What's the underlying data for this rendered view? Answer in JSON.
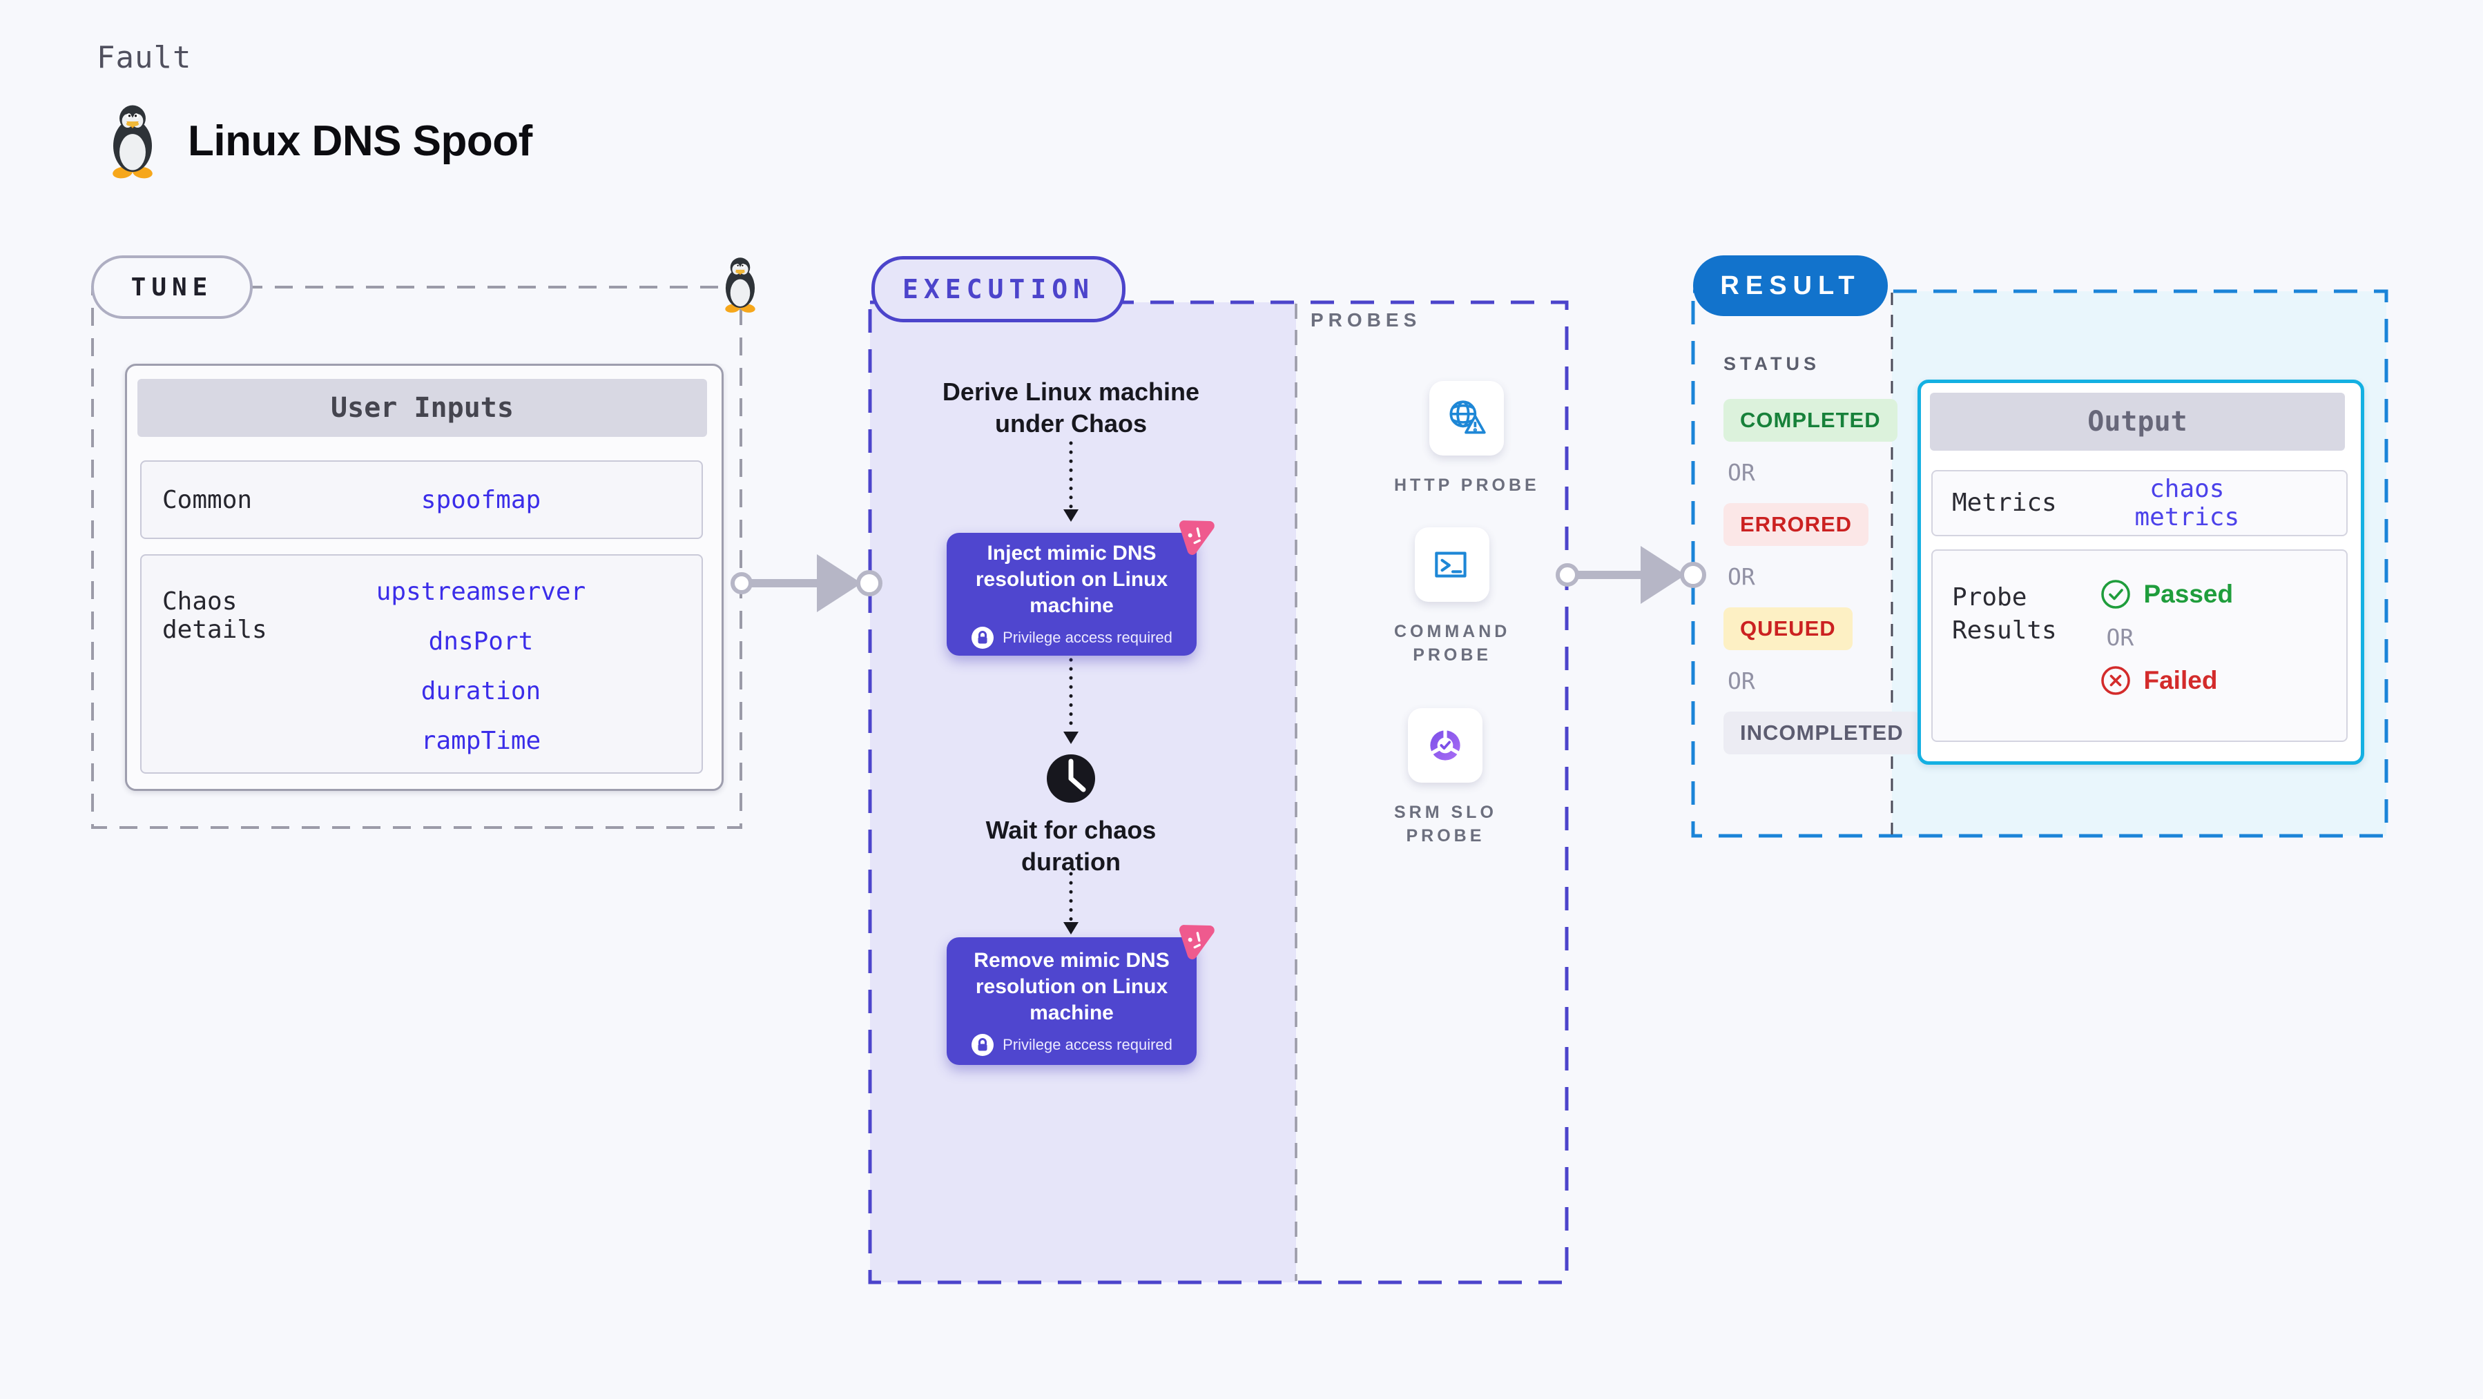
{
  "page": {
    "eyebrow": "Fault",
    "title": "Linux DNS Spoof",
    "background": "#f7f8fc"
  },
  "tune": {
    "label": "TUNE",
    "card_header": "User Inputs",
    "rows": [
      {
        "label": "Common",
        "values": [
          "spoofmap"
        ]
      },
      {
        "label": "Chaos details",
        "values": [
          "upstreamserver",
          "dnsPort",
          "duration",
          "rampTime"
        ]
      }
    ],
    "value_color": "#3b2de9",
    "border_color": "#9b9ba8"
  },
  "execution": {
    "label": "EXECUTION",
    "accent": "#4c44cb",
    "panel_color": "#e6e5f9",
    "steps": {
      "derive": "Derive Linux machine\nunder Chaos",
      "inject": "Inject mimic DNS\nresolution on Linux\nmachine",
      "wait": "Wait for chaos\nduration",
      "remove": "Remove mimic DNS\nresolution on Linux\nmachine",
      "privilege": "Privilege access required"
    },
    "card_color": "#4f46cf",
    "badge_color": "#ef5a8e"
  },
  "probes": {
    "label": "PROBES",
    "items": [
      {
        "label": "HTTP PROBE",
        "icon": "globe-alert-icon"
      },
      {
        "label": "COMMAND\nPROBE",
        "icon": "terminal-icon"
      },
      {
        "label": "SRM SLO\nPROBE",
        "icon": "slo-donut-check-icon"
      }
    ],
    "icon_blue": "#1e87d6",
    "icon_purple": "#8a5cf0"
  },
  "result": {
    "label": "RESULT",
    "accent": "#1b84d8",
    "pill_color": "#1273cc",
    "panel_color": "#e9f6fc",
    "status_heading": "STATUS",
    "or": "OR",
    "statuses": [
      {
        "label": "COMPLETED",
        "fg": "#17813a",
        "bg": "#dcf2dc"
      },
      {
        "label": "ERRORED",
        "fg": "#cb2121",
        "bg": "#fbe7e7"
      },
      {
        "label": "QUEUED",
        "fg": "#cb2121",
        "bg": "#fdf0c4"
      },
      {
        "label": "INCOMPLETED",
        "fg": "#5c5c70",
        "bg": "#ececf3"
      }
    ],
    "output": {
      "header": "Output",
      "metrics_label": "Metrics",
      "metrics_value": "chaos metrics",
      "metrics_value_color": "#4c42ea",
      "probe_results_label": "Probe\nResults",
      "passed": "Passed",
      "passed_color": "#1f9d3c",
      "or": "OR",
      "failed": "Failed",
      "failed_color": "#d32b2b",
      "border_color": "#14b0e2"
    }
  }
}
